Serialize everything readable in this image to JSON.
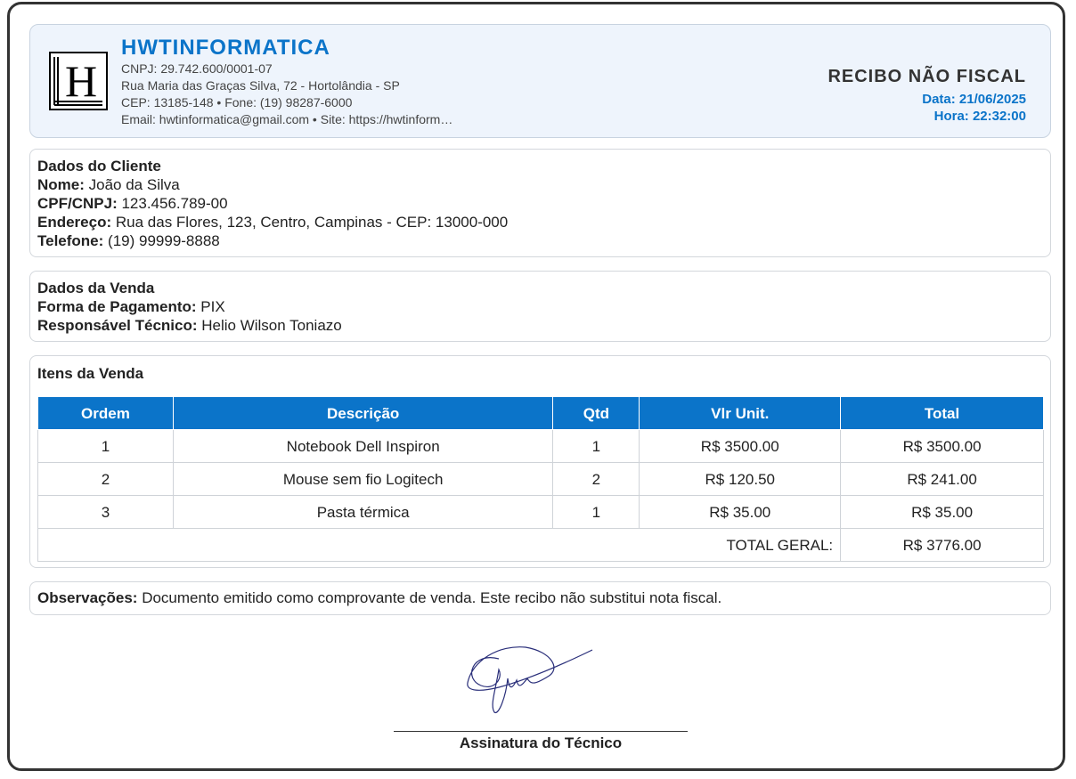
{
  "company": {
    "name": "HWTINFORMATICA",
    "cnpj": "CNPJ: 29.742.600/0001-07",
    "address": "Rua Maria das Graças Silva, 72 - Hortolândia - SP",
    "cep_phone": "CEP: 13185-148 • Fone: (19) 98287-6000",
    "email_site": "Email: hwtinformatica@gmail.com • Site: https://hwtinform…",
    "logo_letter": "H"
  },
  "receipt": {
    "title": "RECIBO NÃO FISCAL",
    "date": "Data: 21/06/2025",
    "time": "Hora: 22:32:00"
  },
  "client": {
    "section_title": "Dados do Cliente",
    "name_label": "Nome:",
    "name": "João da Silva",
    "doc_label": "CPF/CNPJ:",
    "doc": "123.456.789-00",
    "address_label": "Endereço:",
    "address": "Rua das Flores, 123, Centro, Campinas - CEP: 13000-000",
    "phone_label": "Telefone:",
    "phone": "(19) 99999-8888"
  },
  "sale": {
    "section_title": "Dados da Venda",
    "payment_label": "Forma de Pagamento:",
    "payment": "PIX",
    "tech_label": "Responsável Técnico:",
    "tech": "Helio Wilson Toniazo"
  },
  "items": {
    "section_title": "Itens da Venda",
    "headers": [
      "Ordem",
      "Descrição",
      "Qtd",
      "Vlr Unit.",
      "Total"
    ],
    "rows": [
      [
        "1",
        "Notebook Dell Inspiron",
        "1",
        "R$ 3500.00",
        "R$ 3500.00"
      ],
      [
        "2",
        "Mouse sem fio Logitech",
        "2",
        "R$ 120.50",
        "R$ 241.00"
      ],
      [
        "3",
        "Pasta térmica",
        "1",
        "R$ 35.00",
        "R$ 35.00"
      ]
    ],
    "total_label": "TOTAL GERAL:",
    "total_value": "R$ 3776.00"
  },
  "observations": {
    "label": "Observações:",
    "text": "Documento emitido como comprovante de venda. Este recibo não substitui nota fiscal."
  },
  "signature": {
    "label": "Assinatura do Técnico"
  },
  "colors": {
    "accent": "#0b74c9",
    "header_bg": "#eef4fc"
  }
}
